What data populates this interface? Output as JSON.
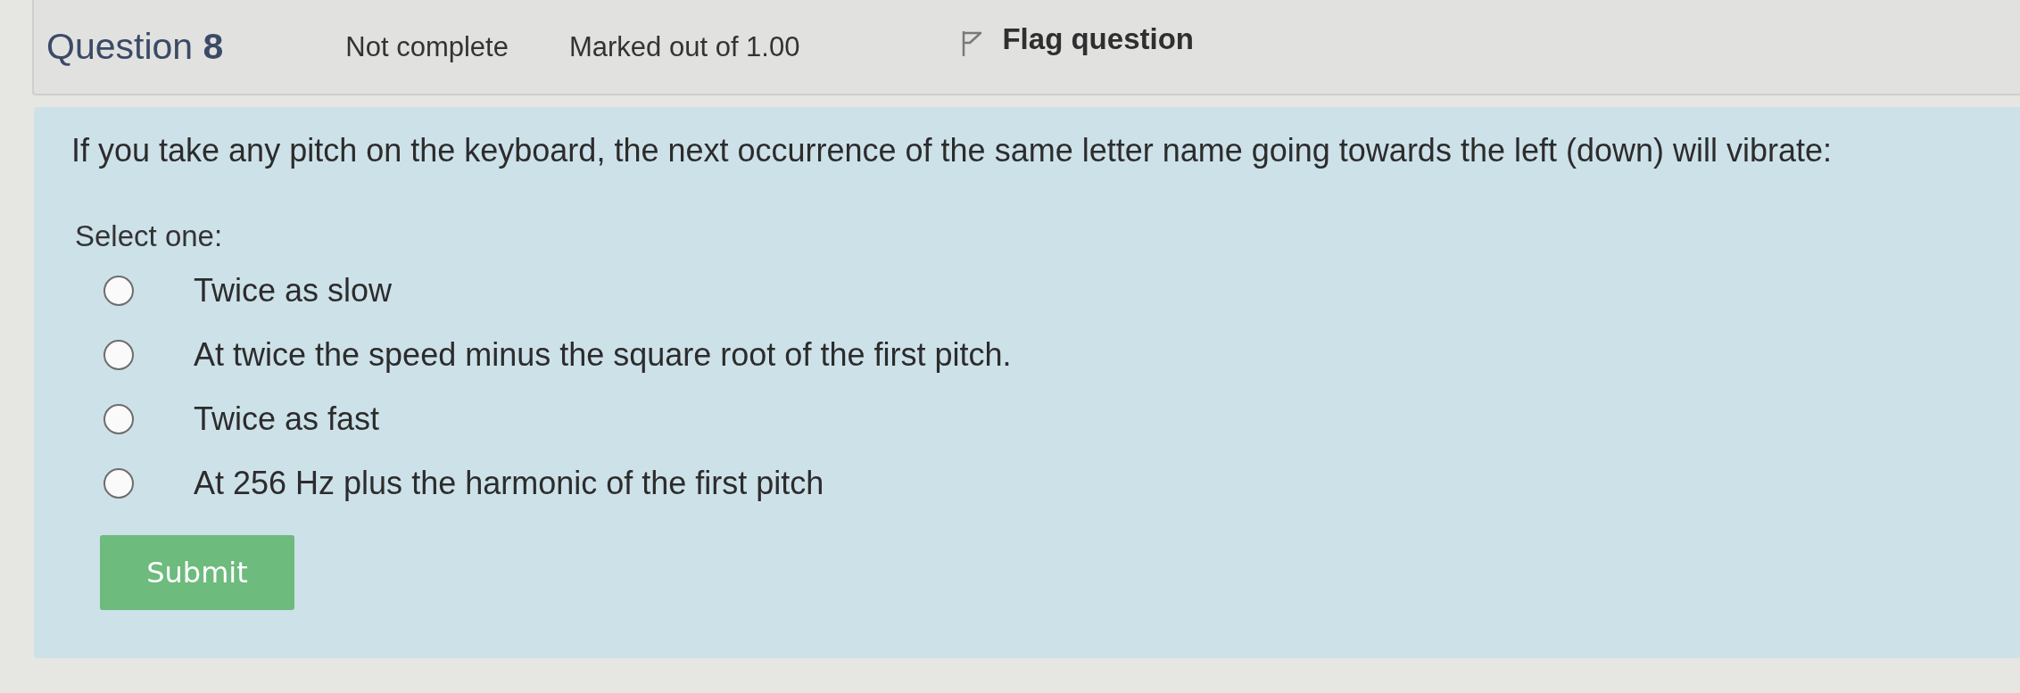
{
  "info": {
    "title": "Question **8**",
    "status": "Not complete",
    "mark": "Marked out of 1.00",
    "flag": "Flag question"
  },
  "question": {
    "text": "If you take any pitch on the keyboard, the next occurrence of the same letter name going towards the left (down) will vibrate:",
    "prompt": "Select one:",
    "options": [
      {
        "label": "Twice as slow",
        "selected": false
      },
      {
        "label": "At twice the speed minus the square root of the first pitch.",
        "selected": false
      },
      {
        "label": "Twice as fast",
        "selected": false
      },
      {
        "label": "At 256 Hz plus the harmonic of the first pitch",
        "selected": false
      }
    ],
    "submit": "Submit"
  }
}
